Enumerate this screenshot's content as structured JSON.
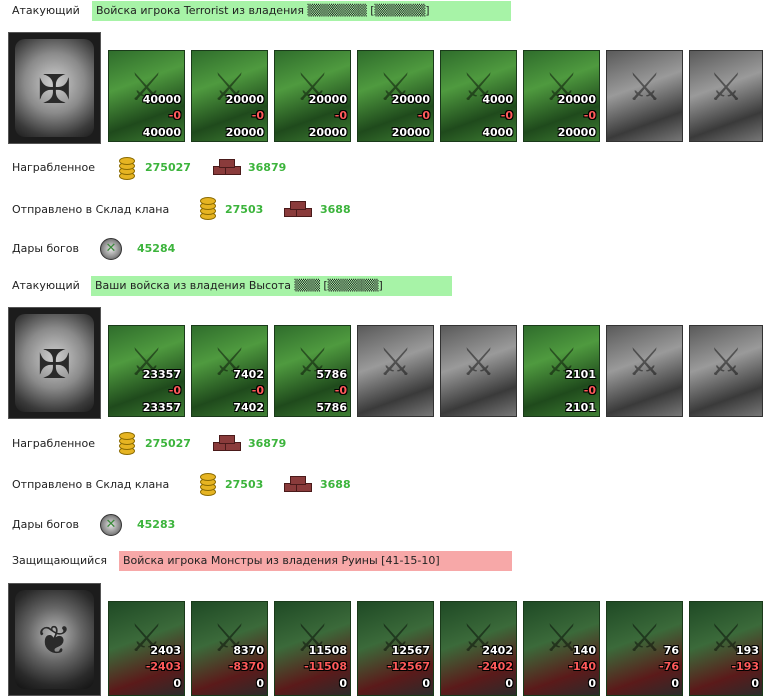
{
  "blocks": [
    {
      "label": "Атакующий",
      "banner": "Войска игрока Terrorist из владения ▒▒▒▒▒▒▒ [▒▒▒▒▒▒]",
      "units": [
        {
          "a": "40000",
          "b": "-0",
          "c": "40000"
        },
        {
          "a": "20000",
          "b": "-0",
          "c": "20000"
        },
        {
          "a": "20000",
          "b": "-0",
          "c": "20000"
        },
        {
          "a": "20000",
          "b": "-0",
          "c": "20000"
        },
        {
          "a": "4000",
          "b": "-0",
          "c": "4000"
        },
        {
          "a": "20000",
          "b": "-0",
          "c": "20000"
        },
        {
          "a": "",
          "b": "",
          "c": ""
        },
        {
          "a": "",
          "b": "",
          "c": ""
        }
      ],
      "loot_label": "Награбленное",
      "loot_gold": "275027",
      "loot_res": "36879",
      "clan_label": "Отправлено в Склад клана",
      "clan_gold": "27503",
      "clan_res": "3688",
      "gods_label": "Дары богов",
      "gods_value": "45284"
    },
    {
      "label": "Атакующий",
      "banner": "Ваши войска из владения Высота ▒▒▒ [▒▒▒▒▒▒]",
      "units": [
        {
          "a": "23357",
          "b": "-0",
          "c": "23357"
        },
        {
          "a": "7402",
          "b": "-0",
          "c": "7402"
        },
        {
          "a": "5786",
          "b": "-0",
          "c": "5786"
        },
        {
          "a": "",
          "b": "",
          "c": ""
        },
        {
          "a": "",
          "b": "",
          "c": ""
        },
        {
          "a": "2101",
          "b": "-0",
          "c": "2101"
        },
        {
          "a": "",
          "b": "",
          "c": ""
        },
        {
          "a": "",
          "b": "",
          "c": ""
        }
      ],
      "loot_label": "Награбленное",
      "loot_gold": "275027",
      "loot_res": "36879",
      "clan_label": "Отправлено в Склад клана",
      "clan_gold": "27503",
      "clan_res": "3688",
      "gods_label": "Дары богов",
      "gods_value": "45283"
    },
    {
      "label": "Защищающийся",
      "banner": "Войска игрока Монстры из владения Руины [41-15-10]",
      "units": [
        {
          "a": "2403",
          "b": "-2403",
          "c": "0"
        },
        {
          "a": "8370",
          "b": "-8370",
          "c": "0"
        },
        {
          "a": "11508",
          "b": "-11508",
          "c": "0"
        },
        {
          "a": "12567",
          "b": "-12567",
          "c": "0"
        },
        {
          "a": "2402",
          "b": "-2402",
          "c": "0"
        },
        {
          "a": "140",
          "b": "-140",
          "c": "0"
        },
        {
          "a": "76",
          "b": "-76",
          "c": "0"
        },
        {
          "a": "193",
          "b": "-193",
          "c": "0"
        }
      ]
    }
  ],
  "colors": {
    "banner_green": "#a7f3a7",
    "banner_red": "#f7a8a8",
    "value_green": "#3cb43c",
    "loss_red": "#ff5a5a"
  }
}
